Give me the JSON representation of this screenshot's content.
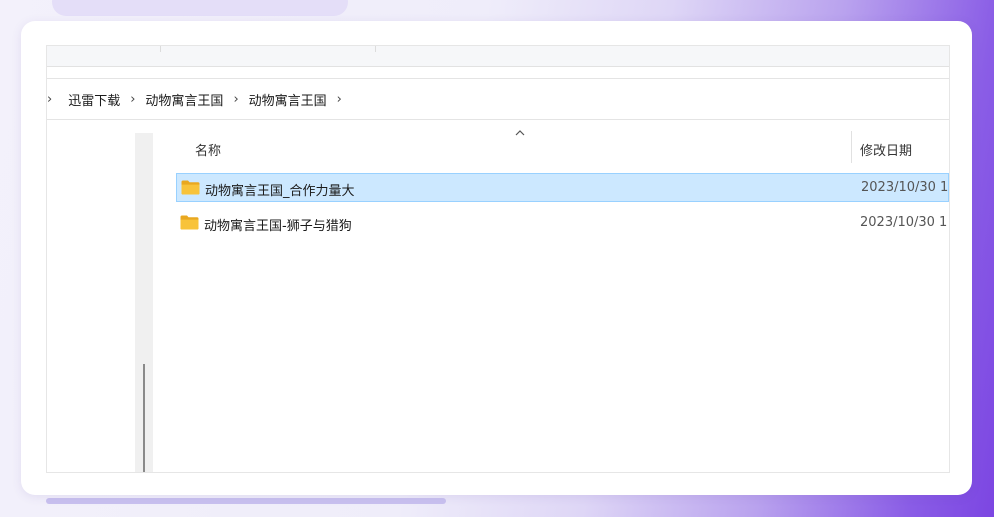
{
  "breadcrumb": {
    "items": [
      "迅雷下载",
      "动物寓言王国",
      "动物寓言王国"
    ]
  },
  "columns": {
    "name": "名称",
    "date": "修改日期"
  },
  "files": [
    {
      "name": "动物寓言王国_合作力量大",
      "date": "2023/10/30 1",
      "type": "folder",
      "selected": true
    },
    {
      "name": "动物寓言王国-狮子与猎狗",
      "date": "2023/10/30 1",
      "type": "folder",
      "selected": false
    }
  ],
  "colors": {
    "selection_bg": "#cce8ff",
    "selection_border": "#99d1ff",
    "folder_yellow": "#f8c33a",
    "accent_purple": "#7c46e2"
  },
  "icons": {
    "folder": "folder-icon",
    "chevron": "chevron-right-icon",
    "sort": "sort-ascending-icon"
  }
}
